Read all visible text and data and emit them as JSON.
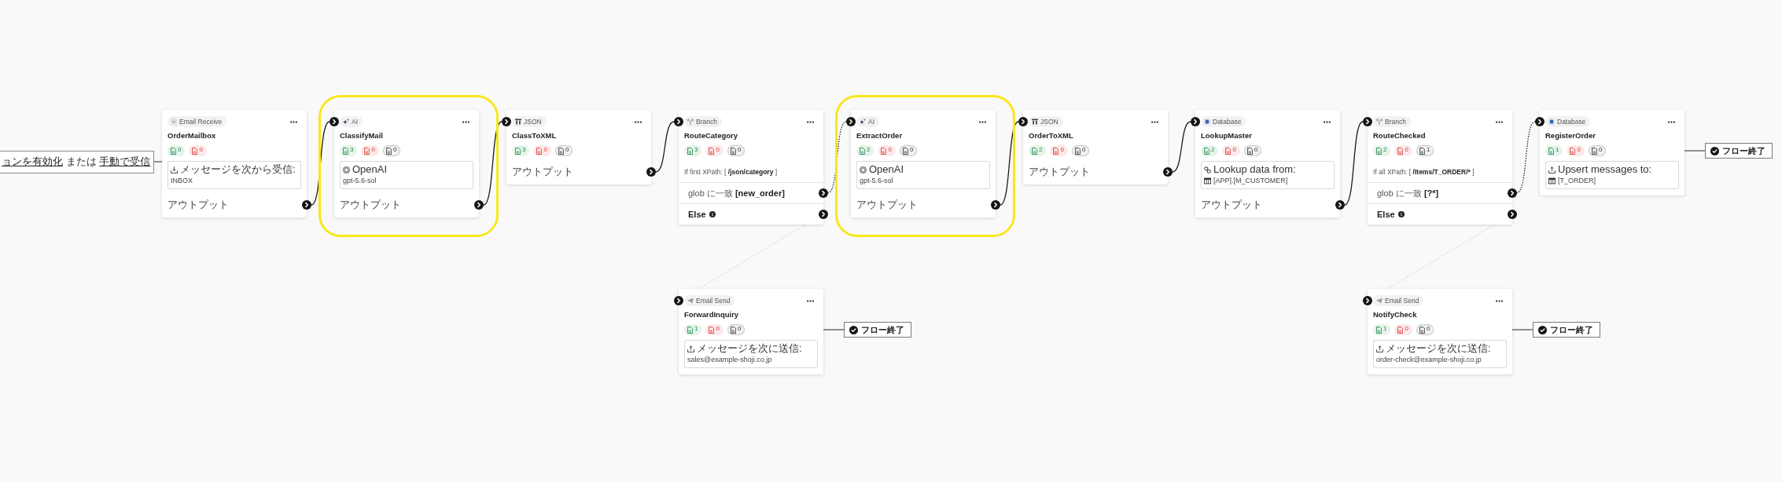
{
  "trigger_hint": {
    "parts": [
      {
        "kind": "link",
        "text": "ョンを有効化"
      },
      {
        "kind": "text",
        "text": "または"
      },
      {
        "kind": "link",
        "text": "手動で受信"
      }
    ]
  },
  "flow": [
    {
      "kind": "email-receive",
      "type_label": "Email Receive",
      "title": "OrderMailbox",
      "highlighted": false,
      "counts": [
        {
          "kind": "success",
          "value": "0"
        },
        {
          "kind": "error",
          "value": "0"
        }
      ],
      "details": [
        {
          "kind": "receive-from",
          "text": "メッセージを次から受信:"
        },
        {
          "kind": "value",
          "text": "INBOX"
        }
      ],
      "output": "アウトプット"
    },
    {
      "kind": "ai",
      "type_label": "AI",
      "title": "ClassifyMail",
      "highlighted": true,
      "counts": [
        {
          "kind": "success",
          "value": "3"
        },
        {
          "kind": "error",
          "value": "0"
        },
        {
          "kind": "other",
          "value": "0"
        }
      ],
      "details": [
        {
          "kind": "provider",
          "text": "OpenAI"
        },
        {
          "kind": "value",
          "text": "gpt-5.6-sol"
        }
      ],
      "output": "アウトプット"
    },
    {
      "kind": "json",
      "type_label": "JSON",
      "title": "ClassToXML",
      "highlighted": false,
      "counts": [
        {
          "kind": "success",
          "value": "3"
        },
        {
          "kind": "error",
          "value": "0"
        },
        {
          "kind": "other",
          "value": "0"
        }
      ],
      "output": "アウトプット"
    },
    {
      "kind": "branch",
      "type_label": "Branch",
      "title": "RouteCategory",
      "highlighted": false,
      "counts": [
        {
          "kind": "success",
          "value": "3"
        },
        {
          "kind": "error",
          "value": "0"
        },
        {
          "kind": "other",
          "value": "0"
        }
      ],
      "condition": [
        {
          "text": "If first XPath:",
          "strong": false
        },
        {
          "text": "[",
          "strong": false
        },
        {
          "text": "/json/category",
          "strong": true
        },
        {
          "text": "]",
          "strong": false
        }
      ],
      "match": [
        {
          "text": "glob に一致",
          "strong": false
        },
        {
          "text": "[new_order]",
          "strong": true
        }
      ],
      "else": {
        "label": "Else",
        "flow": [
          {
            "kind": "email-send",
            "type_label": "Email Send",
            "title": "ForwardInquiry",
            "highlighted": false,
            "counts": [
              {
                "kind": "success",
                "value": "1"
              },
              {
                "kind": "error",
                "value": "0"
              },
              {
                "kind": "other",
                "value": "0"
              }
            ],
            "details": [
              {
                "kind": "send-to",
                "text": "メッセージを次に送信:"
              },
              {
                "kind": "value",
                "text": "sales@example-shoji.co.jp"
              }
            ],
            "end_label": "フロー終了"
          }
        ]
      }
    },
    {
      "kind": "ai",
      "type_label": "AI",
      "title": "ExtractOrder",
      "highlighted": true,
      "counts": [
        {
          "kind": "success",
          "value": "2"
        },
        {
          "kind": "error",
          "value": "0"
        },
        {
          "kind": "other",
          "value": "0"
        }
      ],
      "details": [
        {
          "kind": "provider",
          "text": "OpenAI"
        },
        {
          "kind": "value",
          "text": "gpt-5.6-sol"
        }
      ],
      "output": "アウトプット"
    },
    {
      "kind": "json",
      "type_label": "JSON",
      "title": "OrderToXML",
      "highlighted": false,
      "counts": [
        {
          "kind": "success",
          "value": "2"
        },
        {
          "kind": "error",
          "value": "0"
        },
        {
          "kind": "other",
          "value": "0"
        }
      ],
      "output": "アウトプット"
    },
    {
      "kind": "database",
      "type_label": "Database",
      "title": "LookupMaster",
      "highlighted": false,
      "counts": [
        {
          "kind": "success",
          "value": "2"
        },
        {
          "kind": "error",
          "value": "0"
        },
        {
          "kind": "other",
          "value": "0"
        }
      ],
      "details": [
        {
          "kind": "lookup-from",
          "text": "Lookup data from:"
        },
        {
          "kind": "table",
          "text": "[APP].[M_CUSTOMER]"
        }
      ],
      "output": "アウトプット"
    },
    {
      "kind": "branch",
      "type_label": "Branch",
      "title": "RouteChecked",
      "highlighted": false,
      "counts": [
        {
          "kind": "success",
          "value": "2"
        },
        {
          "kind": "error",
          "value": "0"
        },
        {
          "kind": "other",
          "value": "1"
        }
      ],
      "condition": [
        {
          "text": "If all XPath:",
          "strong": false
        },
        {
          "text": "[",
          "strong": false
        },
        {
          "text": "/Items/T_ORDER/*",
          "strong": true
        },
        {
          "text": "]",
          "strong": false
        }
      ],
      "match": [
        {
          "text": "glob に一致",
          "strong": false
        },
        {
          "text": "[?*]",
          "strong": true
        }
      ],
      "else": {
        "label": "Else",
        "flow": [
          {
            "kind": "email-send",
            "type_label": "Email Send",
            "title": "NotifyCheck",
            "highlighted": false,
            "counts": [
              {
                "kind": "success",
                "value": "1"
              },
              {
                "kind": "error",
                "value": "0"
              },
              {
                "kind": "other",
                "value": "0"
              }
            ],
            "details": [
              {
                "kind": "send-to",
                "text": "メッセージを次に送信:"
              },
              {
                "kind": "value",
                "text": "order-check@example-shoji.co.jp"
              }
            ],
            "end_label": "フロー終了"
          }
        ]
      }
    },
    {
      "kind": "database",
      "type_label": "Database",
      "title": "RegisterOrder",
      "highlighted": false,
      "counts": [
        {
          "kind": "success",
          "value": "1"
        },
        {
          "kind": "error",
          "value": "0"
        },
        {
          "kind": "other",
          "value": "0"
        }
      ],
      "details": [
        {
          "kind": "send-to",
          "text": "Upsert messages to:"
        },
        {
          "kind": "table",
          "text": "[T_ORDER]"
        }
      ],
      "end_label": "フロー終了"
    }
  ]
}
